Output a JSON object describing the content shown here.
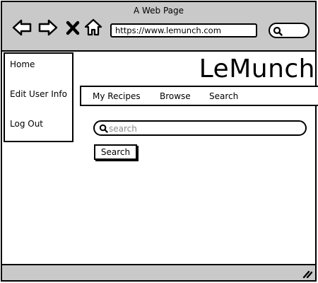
{
  "window": {
    "title": "A Web Page"
  },
  "browser": {
    "url": "https://www.lemunch.com",
    "icons": {
      "back": "back-arrow-icon",
      "forward": "forward-arrow-icon",
      "stop": "close-icon",
      "home": "home-icon",
      "search": "search-icon"
    }
  },
  "sidebar": {
    "items": [
      {
        "label": "Home"
      },
      {
        "label": "Edit User Info"
      },
      {
        "label": "Log Out"
      }
    ]
  },
  "header": {
    "brand": "LeMunch"
  },
  "tabs": [
    {
      "label": "My Recipes"
    },
    {
      "label": "Browse"
    },
    {
      "label": "Search"
    }
  ],
  "search": {
    "placeholder": "search",
    "value": "",
    "button_label": "Search"
  },
  "colors": {
    "chrome": "#c9c9c9",
    "border": "#000000",
    "background": "#ffffff",
    "placeholder": "#8a8a8a"
  }
}
